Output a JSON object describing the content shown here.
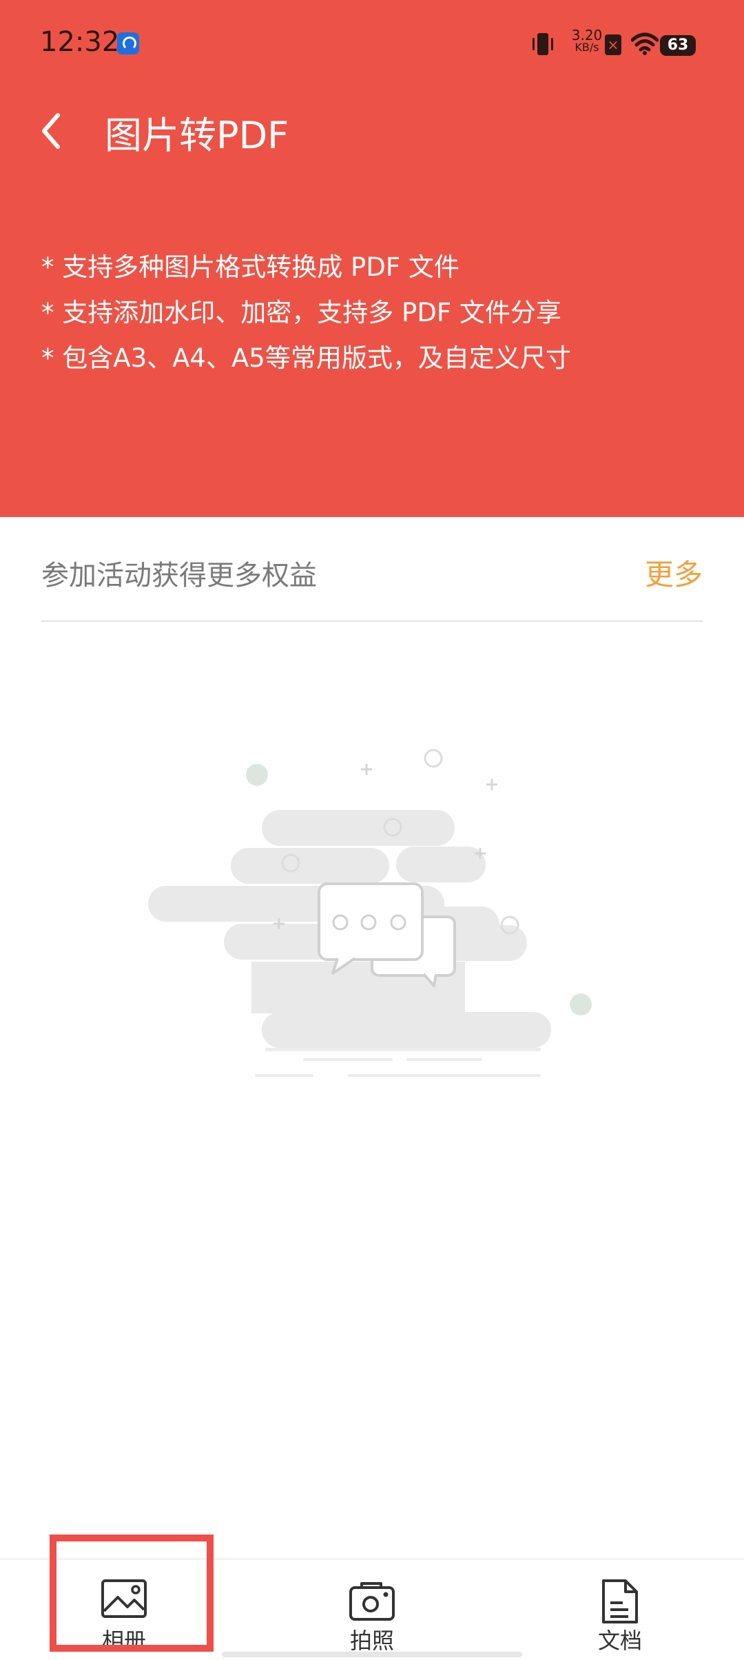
{
  "status_bar": {
    "time": "12:32",
    "net_speed_value": "3.20",
    "net_speed_unit": "KB/s",
    "battery": "63",
    "sim_mark": "×"
  },
  "header": {
    "title": "图片转PDF",
    "features": [
      "* 支持多种图片格式转换成 PDF 文件",
      "* 支持添加水印、加密，支持多 PDF 文件分享",
      "* 包含A3、A4、A5等常用版式，及自定义尺寸"
    ]
  },
  "promo": {
    "text": "参加活动获得更多权益",
    "more_label": "更多"
  },
  "bottom_nav": {
    "items": [
      {
        "label": "相册",
        "icon": "image-icon"
      },
      {
        "label": "拍照",
        "icon": "camera-icon"
      },
      {
        "label": "文档",
        "icon": "document-icon"
      }
    ]
  },
  "colors": {
    "header_bg": "#ec5346",
    "accent_more": "#f0a13c",
    "highlight": "#ee4f4a"
  }
}
